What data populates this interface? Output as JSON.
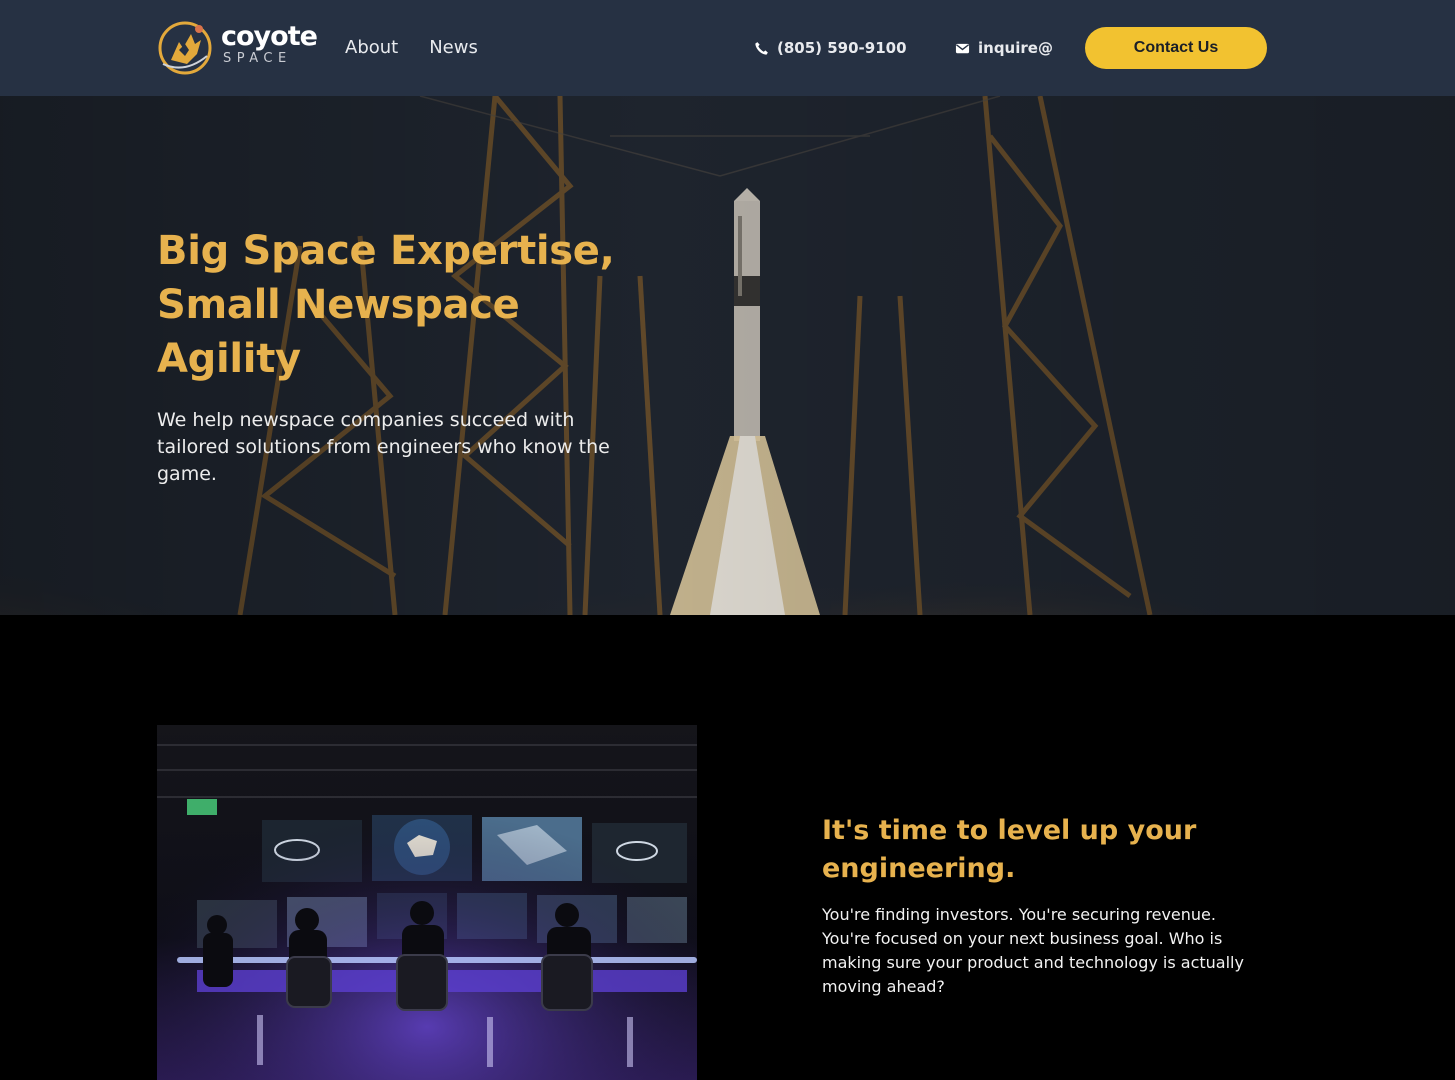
{
  "header": {
    "brand": {
      "name": "coyote",
      "tagline": "SPACE"
    },
    "nav": [
      {
        "label": "About"
      },
      {
        "label": "News"
      }
    ],
    "phone": {
      "icon": "phone-icon",
      "text": "(805) 590-9100"
    },
    "email": {
      "icon": "envelope-icon",
      "text": "inquire@"
    },
    "cta_label": "Contact Us"
  },
  "hero": {
    "title": "Big Space Expertise, Small Newspace Agility",
    "subtitle": "We help newspace companies succeed with tailored solutions from engineers who know the game."
  },
  "section2": {
    "heading": "It's time to level up your engineering.",
    "body": "You're finding investors.  You're securing revenue.  You're focused on your next business goal.  Who is making sure your product and technology is actually moving ahead?"
  },
  "colors": {
    "header_bg": "#263143",
    "accent_yellow": "#f2c230",
    "heading_gold": "#e7b24e",
    "page_bg": "#000000"
  }
}
